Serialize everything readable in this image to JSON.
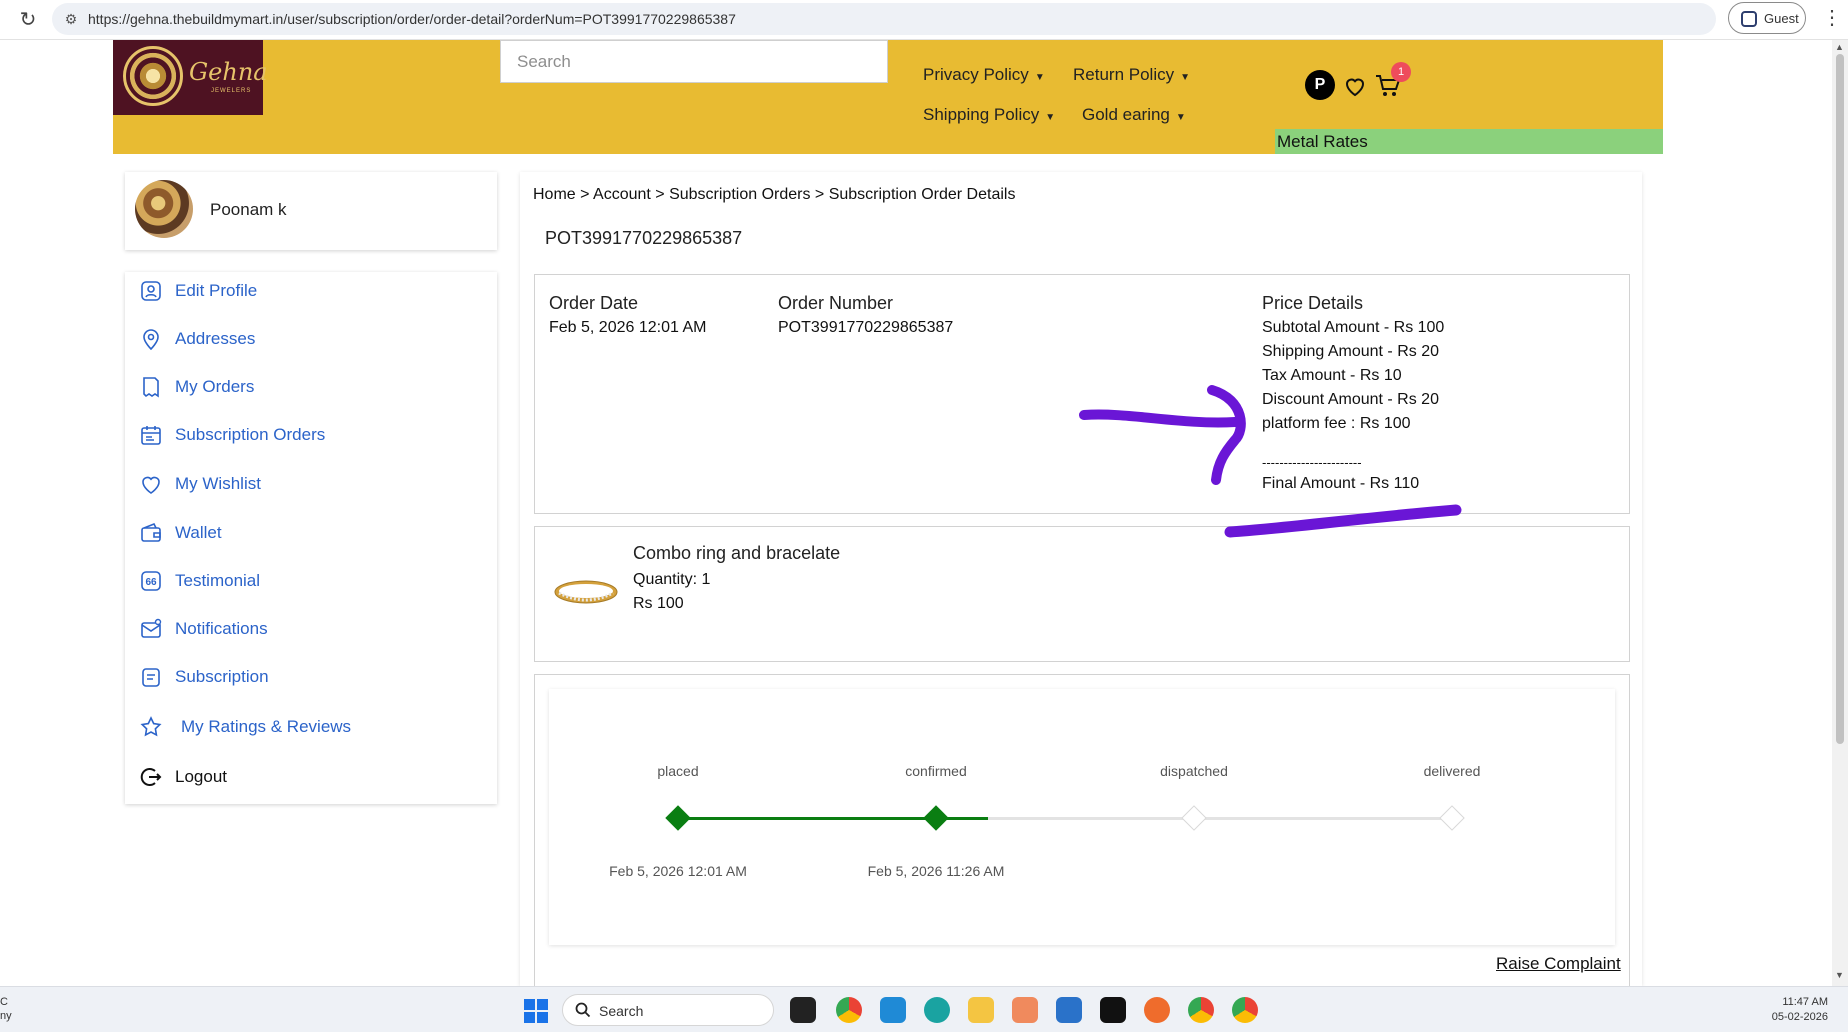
{
  "browser": {
    "url": "https://gehna.thebuildmymart.in/user/subscription/order/order-detail?orderNum=POT3991770229865387",
    "profile_label": "Guest"
  },
  "header": {
    "logo_text": "Gehna",
    "logo_sub": "JEWELERS",
    "search_placeholder": "Search",
    "nav": {
      "privacy": "Privacy Policy",
      "return": "Return Policy",
      "shipping": "Shipping Policy",
      "gold": "Gold earing"
    },
    "avatar_initial": "P",
    "cart_count": "1",
    "metal_rates": "Metal Rates"
  },
  "profile": {
    "name": "Poonam k"
  },
  "sidebar": {
    "items": [
      {
        "label": "Edit Profile",
        "icon": "user-icon"
      },
      {
        "label": "Addresses",
        "icon": "location-pin-icon"
      },
      {
        "label": "My Orders",
        "icon": "orders-icon"
      },
      {
        "label": "Subscription Orders",
        "icon": "calendar-icon"
      },
      {
        "label": "My Wishlist",
        "icon": "heart-icon"
      },
      {
        "label": "Wallet",
        "icon": "wallet-icon"
      },
      {
        "label": "Testimonial",
        "icon": "quote-icon"
      },
      {
        "label": "Notifications",
        "icon": "mail-icon"
      },
      {
        "label": "Subscription",
        "icon": "subscription-icon"
      },
      {
        "label": "My Ratings & Reviews",
        "icon": "star-icon"
      },
      {
        "label": "Logout",
        "icon": "logout-icon"
      }
    ]
  },
  "breadcrumb": "Home > Account > Subscription Orders > Subscription Order Details",
  "order": {
    "title": "POT3991770229865387",
    "date_label": "Order Date",
    "date_value": "Feb 5, 2026 12:01 AM",
    "number_label": "Order Number",
    "number_value": "POT3991770229865387",
    "price_label": "Price Details",
    "price_lines": [
      "Subtotal Amount - Rs 100",
      "Shipping Amount - Rs 20",
      "Tax Amount - Rs 10",
      "Discount Amount - Rs 20",
      "platform fee :  Rs 100"
    ],
    "separator": "-----------------------",
    "final": "Final Amount - Rs 110"
  },
  "item": {
    "name": "Combo ring and bracelate",
    "quantity": "Quantity: 1",
    "price": "Rs 100"
  },
  "tracking": {
    "steps": [
      {
        "label": "placed",
        "date": "Feb 5, 2026 12:01 AM",
        "done": true
      },
      {
        "label": "confirmed",
        "date": "Feb 5, 2026 11:26 AM",
        "done": true
      },
      {
        "label": "dispatched",
        "date": "",
        "done": false
      },
      {
        "label": "delivered",
        "date": "",
        "done": false
      }
    ],
    "progress_fraction": 0.4,
    "done_color": "#0a7e12",
    "pending_color": "#e3e3e3"
  },
  "raise_complaint": "Raise Complaint",
  "annotation_color": "#6a16d6",
  "taskbar": {
    "left_line1": "C",
    "left_line2": "ny",
    "search_label": "Search",
    "time": "11:47 AM",
    "date": "05-02-2026"
  },
  "colors": {
    "header_bg": "#e8bb32",
    "logo_bg": "#4e1222",
    "metal_rates_bg": "#8bd17c",
    "link_blue": "#2b63c9"
  }
}
